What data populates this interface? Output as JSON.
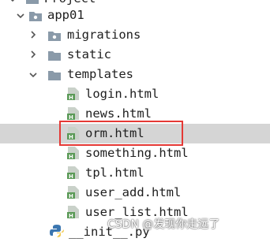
{
  "tree": {
    "header_partial": "Project",
    "app": "app01",
    "migrations": "migrations",
    "static": "static",
    "templates": "templates",
    "files": [
      "login.html",
      "news.html",
      "orm.html",
      "something.html",
      "tpl.html",
      "user_add.html",
      "user_list.html"
    ],
    "bottom_file": "__init__.py"
  },
  "selected_file": "orm.html",
  "highlight_color": "#e53935",
  "watermark": "CSDN @发现你走远了"
}
